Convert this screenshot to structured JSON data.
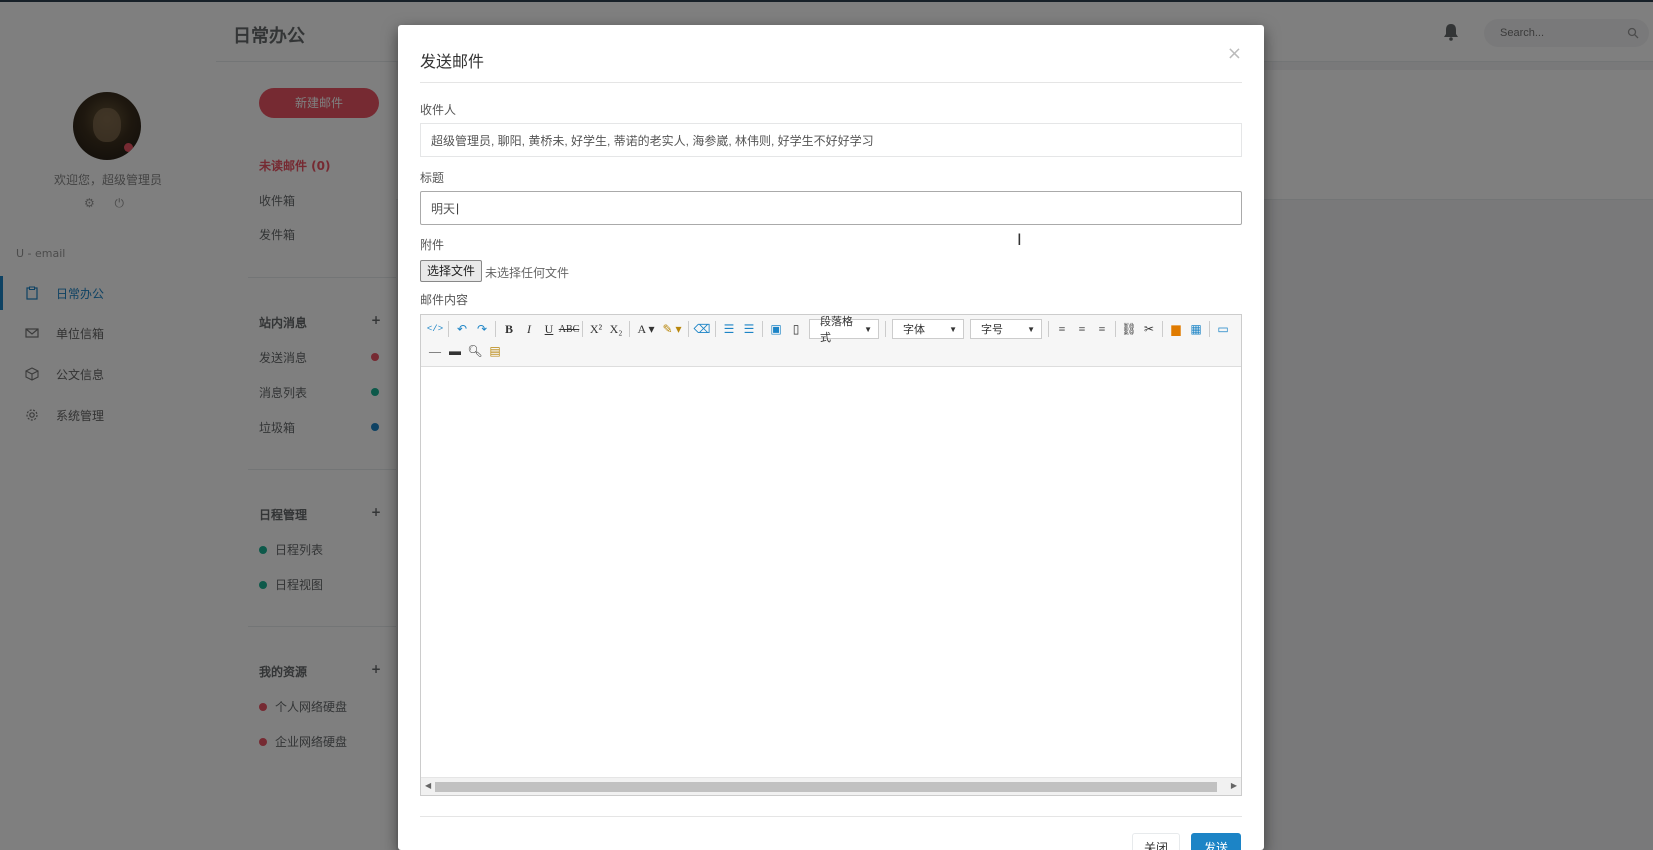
{
  "sidebar": {
    "welcome": "欢迎您，超级管理员",
    "user_icons": "⚙ ⏻",
    "brand": "U - email",
    "items": [
      {
        "label": "日常办公",
        "icon": "clipboard-icon",
        "active": true
      },
      {
        "label": "单位信箱",
        "icon": "envelope-icon",
        "active": false
      },
      {
        "label": "公文信息",
        "icon": "cube-icon",
        "active": false
      },
      {
        "label": "系统管理",
        "icon": "gear-icon",
        "active": false
      }
    ]
  },
  "header": {
    "title": "日常办公",
    "search_placeholder": "Search..."
  },
  "mailbox": {
    "compose_label": "新建邮件",
    "unread_label": "未读邮件 (0)",
    "inbox_label": "收件箱",
    "sent_label": "发件箱",
    "section_messages": "站内消息",
    "messages": [
      {
        "label": "发送消息",
        "color": "#ed5565"
      },
      {
        "label": "消息列表",
        "color": "#1ab394"
      },
      {
        "label": "垃圾箱",
        "color": "#1c84c6"
      }
    ],
    "section_schedule": "日程管理",
    "schedule": [
      {
        "label": "日程列表",
        "color": "#1ab394"
      },
      {
        "label": "日程视图",
        "color": "#1ab394"
      }
    ],
    "section_resources": "我的资源",
    "resources": [
      {
        "label": "个人网络硬盘",
        "color": "#ed5565"
      },
      {
        "label": "企业网络硬盘",
        "color": "#ed5565"
      }
    ],
    "plus": "+"
  },
  "modal": {
    "title": "发送邮件",
    "close_symbol": "×",
    "recipients_label": "收件人",
    "recipients_value": "超级管理员, 聊阳, 黄桥未, 好学生, 蒂诺的老实人, 海参崴, 林伟则, 好学生不好好学习",
    "subject_label": "标题",
    "subject_value": "明天",
    "attachment_label": "附件",
    "file_button": "选择文件",
    "file_status": "未选择任何文件",
    "content_label": "邮件内容",
    "toolbar": {
      "paragraph_format": "段落格式",
      "font_family": "字体",
      "font_size": "字号"
    },
    "close_button": "关闭",
    "send_button": "发送"
  },
  "colors": {
    "accent": "#1c84c6",
    "danger": "#ed5565",
    "success": "#1ab394"
  }
}
